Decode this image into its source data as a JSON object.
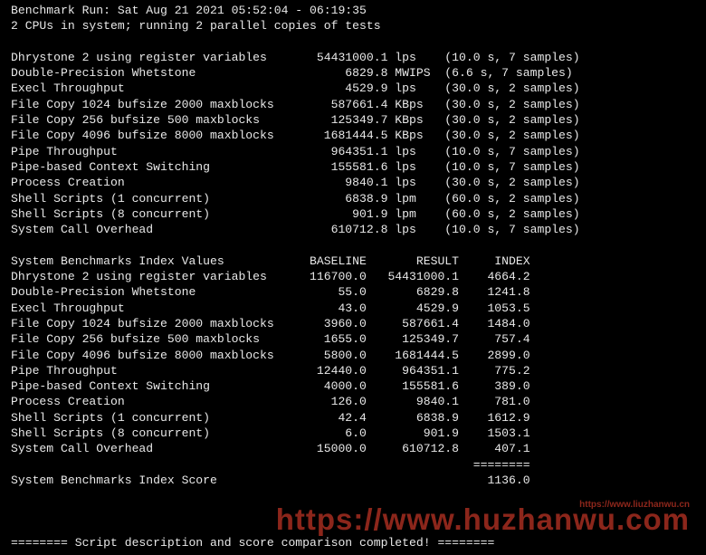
{
  "header": {
    "line1": "Benchmark Run: Sat Aug 21 2021 05:52:04 - 06:19:35",
    "line2": "2 CPUs in system; running 2 parallel copies of tests"
  },
  "raw_results": [
    {
      "name": "Dhrystone 2 using register variables",
      "value": "54431000.1",
      "unit": "lps",
      "note": "(10.0 s, 7 samples)"
    },
    {
      "name": "Double-Precision Whetstone",
      "value": "6829.8",
      "unit": "MWIPS",
      "note": "(6.6 s, 7 samples)"
    },
    {
      "name": "Execl Throughput",
      "value": "4529.9",
      "unit": "lps",
      "note": "(30.0 s, 2 samples)"
    },
    {
      "name": "File Copy 1024 bufsize 2000 maxblocks",
      "value": "587661.4",
      "unit": "KBps",
      "note": "(30.0 s, 2 samples)"
    },
    {
      "name": "File Copy 256 bufsize 500 maxblocks",
      "value": "125349.7",
      "unit": "KBps",
      "note": "(30.0 s, 2 samples)"
    },
    {
      "name": "File Copy 4096 bufsize 8000 maxblocks",
      "value": "1681444.5",
      "unit": "KBps",
      "note": "(30.0 s, 2 samples)"
    },
    {
      "name": "Pipe Throughput",
      "value": "964351.1",
      "unit": "lps",
      "note": "(10.0 s, 7 samples)"
    },
    {
      "name": "Pipe-based Context Switching",
      "value": "155581.6",
      "unit": "lps",
      "note": "(10.0 s, 7 samples)"
    },
    {
      "name": "Process Creation",
      "value": "9840.1",
      "unit": "lps",
      "note": "(30.0 s, 2 samples)"
    },
    {
      "name": "Shell Scripts (1 concurrent)",
      "value": "6838.9",
      "unit": "lpm",
      "note": "(60.0 s, 2 samples)"
    },
    {
      "name": "Shell Scripts (8 concurrent)",
      "value": "901.9",
      "unit": "lpm",
      "note": "(60.0 s, 2 samples)"
    },
    {
      "name": "System Call Overhead",
      "value": "610712.8",
      "unit": "lps",
      "note": "(10.0 s, 7 samples)"
    }
  ],
  "index_table": {
    "title": "System Benchmarks Index Values",
    "col_baseline": "BASELINE",
    "col_result": "RESULT",
    "col_index": "INDEX",
    "rows": [
      {
        "name": "Dhrystone 2 using register variables",
        "baseline": "116700.0",
        "result": "54431000.1",
        "index": "4664.2"
      },
      {
        "name": "Double-Precision Whetstone",
        "baseline": "55.0",
        "result": "6829.8",
        "index": "1241.8"
      },
      {
        "name": "Execl Throughput",
        "baseline": "43.0",
        "result": "4529.9",
        "index": "1053.5"
      },
      {
        "name": "File Copy 1024 bufsize 2000 maxblocks",
        "baseline": "3960.0",
        "result": "587661.4",
        "index": "1484.0"
      },
      {
        "name": "File Copy 256 bufsize 500 maxblocks",
        "baseline": "1655.0",
        "result": "125349.7",
        "index": "757.4"
      },
      {
        "name": "File Copy 4096 bufsize 8000 maxblocks",
        "baseline": "5800.0",
        "result": "1681444.5",
        "index": "2899.0"
      },
      {
        "name": "Pipe Throughput",
        "baseline": "12440.0",
        "result": "964351.1",
        "index": "775.2"
      },
      {
        "name": "Pipe-based Context Switching",
        "baseline": "4000.0",
        "result": "155581.6",
        "index": "389.0"
      },
      {
        "name": "Process Creation",
        "baseline": "126.0",
        "result": "9840.1",
        "index": "781.0"
      },
      {
        "name": "Shell Scripts (1 concurrent)",
        "baseline": "42.4",
        "result": "6838.9",
        "index": "1612.9"
      },
      {
        "name": "Shell Scripts (8 concurrent)",
        "baseline": "6.0",
        "result": "901.9",
        "index": "1503.1"
      },
      {
        "name": "System Call Overhead",
        "baseline": "15000.0",
        "result": "610712.8",
        "index": "407.1"
      }
    ],
    "sep": "========",
    "score_label": "System Benchmarks Index Score",
    "score_value": "1136.0"
  },
  "footer": {
    "line": "======== Script description and score comparison completed! ========"
  },
  "watermark": {
    "big": "https://www.huzhanwu.com",
    "small": "https://www.liuzhanwu.cn"
  }
}
